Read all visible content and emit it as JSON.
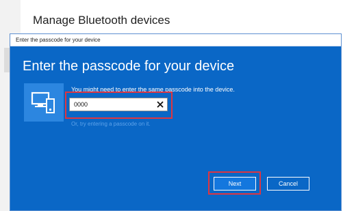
{
  "background": {
    "page_title": "Manage Bluetooth devices"
  },
  "dialog": {
    "window_title": "Enter the passcode for your device",
    "heading": "Enter the passcode for your device",
    "device_icon": "devices-icon",
    "prompt": "You might need to enter the same passcode into the device.",
    "passcode": {
      "value": "0000",
      "clear_icon": "close-icon"
    },
    "hint": "Or, try entering a passcode on it.",
    "buttons": {
      "next": "Next",
      "cancel": "Cancel"
    }
  },
  "colors": {
    "dialog_background": "#0a67c6",
    "device_tile": "#2c86e0",
    "highlight": "#e0353f",
    "primary_button": "#1477de",
    "hint_text": "#5fa3ea"
  }
}
